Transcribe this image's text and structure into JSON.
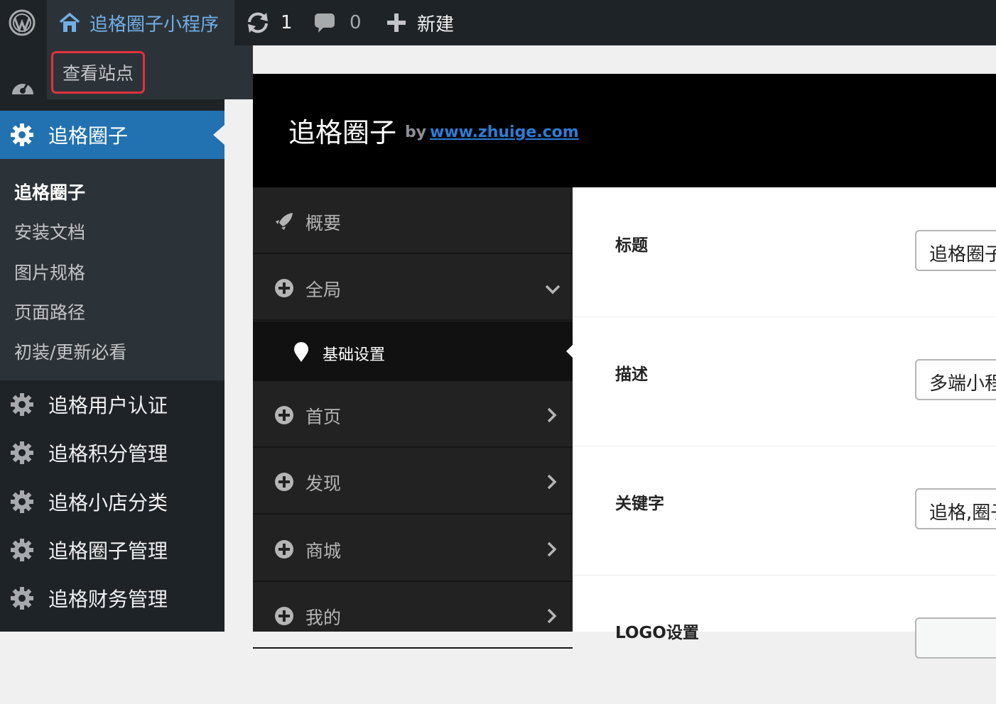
{
  "admin_bar": {
    "wp_logo_icon": "wordpress-logo-icon",
    "site_name": "追格圈子小程序",
    "updates_count": "1",
    "comments_count": "0",
    "new_label": "新建"
  },
  "site_dropdown": {
    "view_site": "查看站点"
  },
  "sidebar": {
    "current_menu": "追格圈子",
    "submenu": [
      "追格圈子",
      "安装文档",
      "图片规格",
      "页面路径",
      "初装/更新必看"
    ],
    "menu_items": [
      "追格用户认证",
      "追格积分管理",
      "追格小店分类",
      "追格圈子管理",
      "追格财务管理"
    ]
  },
  "plugin": {
    "title": "追格圈子",
    "by": "by",
    "link_text": "www.zhuige.com"
  },
  "plugin_nav": {
    "items": [
      "概要",
      "全局",
      "基础设置",
      "首页",
      "发现",
      "商城",
      "我的"
    ]
  },
  "fields": [
    {
      "label": "标题",
      "value": "追格圈子"
    },
    {
      "label": "描述",
      "value": "多端小程序"
    },
    {
      "label": "关键字",
      "value": "追格,圈子"
    },
    {
      "label": "LOGO设置",
      "value": ""
    }
  ],
  "colors": {
    "admin_bar_bg": "#1d2327",
    "accent_blue": "#2271b1",
    "highlight_red": "#e2323b",
    "link_blue": "#2f7cd6"
  }
}
